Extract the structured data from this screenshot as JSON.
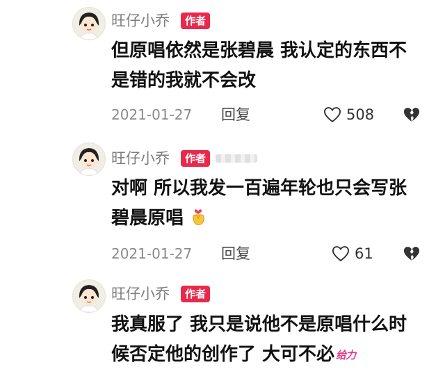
{
  "comments": [
    {
      "username": "旺仔小乔",
      "badge": "作者",
      "text": "但原唱依然是张碧晨 我认定的东西不是错的我就不会改",
      "date": "2021-01-27",
      "reply_label": "回复",
      "likes": "508"
    },
    {
      "username": "旺仔小乔",
      "badge": "作者",
      "text": "对啊 所以我发一百遍年轮也只会写张碧晨原唱",
      "date": "2021-01-27",
      "reply_label": "回复",
      "likes": "61"
    },
    {
      "username": "旺仔小乔",
      "badge": "作者",
      "text": "我真服了 我只是说他不是原唱什么时候否定他的创作了 大可不必",
      "sticker": "给力"
    }
  ],
  "colors": {
    "badge": "#e8294c",
    "sticker": "#e33a8a"
  },
  "icons": [
    "avatar-girl",
    "heart-outline-icon",
    "broken-heart-icon",
    "finger-heart-emoji"
  ]
}
